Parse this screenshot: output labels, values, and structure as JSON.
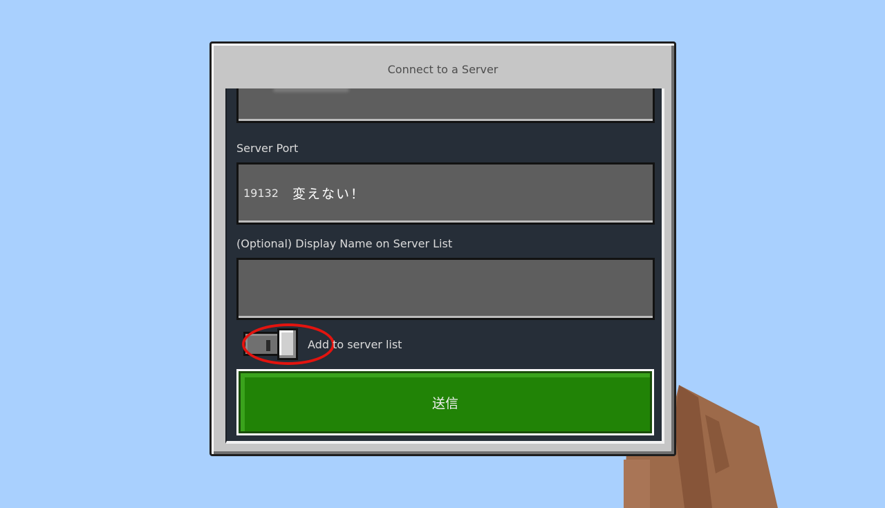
{
  "window": {
    "title": "Connect to a Server"
  },
  "server_port": {
    "label": "Server Port",
    "value": "19132",
    "note": "変えない！"
  },
  "display_name": {
    "label": "(Optional) Display Name on Server List",
    "value": ""
  },
  "add_to_list": {
    "label": "Add to server list",
    "state": "off"
  },
  "submit": {
    "label": "送信"
  },
  "colors": {
    "sky": "#a9d0fe",
    "panel": "#262e38",
    "submit_green": "#218306",
    "annotation_red": "#e3140f"
  }
}
